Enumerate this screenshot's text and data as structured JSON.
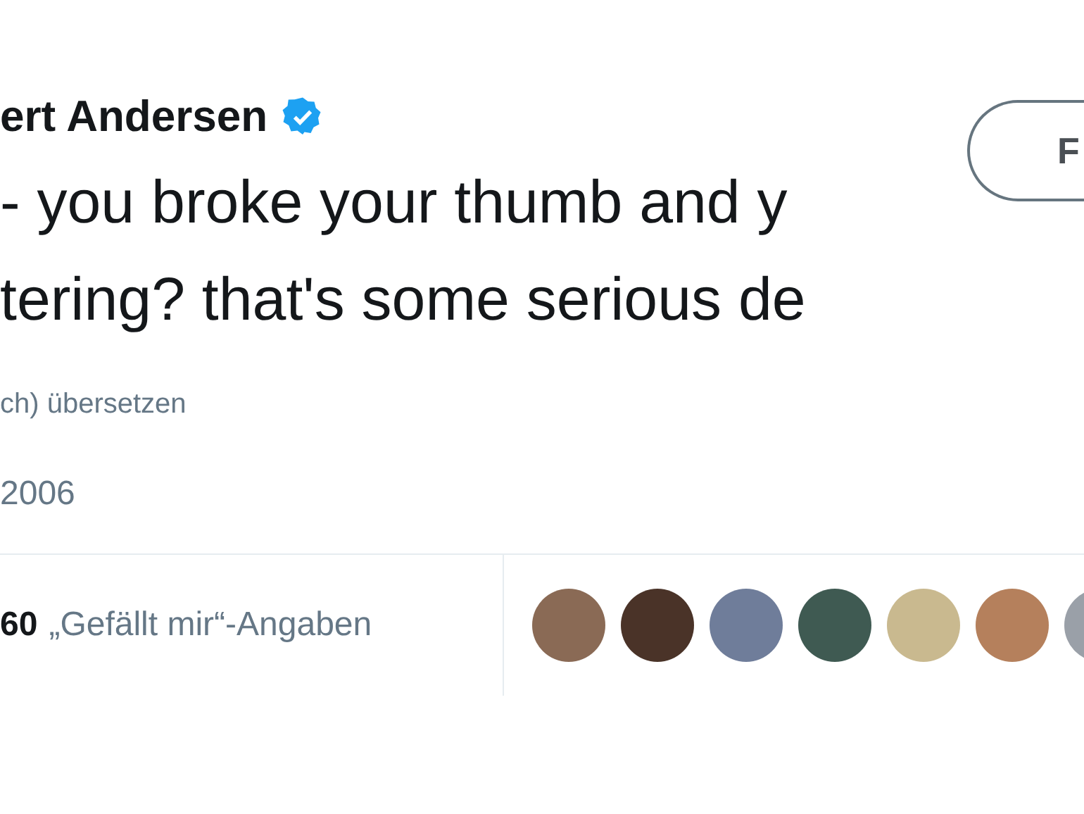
{
  "author": {
    "name": "ert Andersen",
    "verified": true
  },
  "follow_button": {
    "label": "F"
  },
  "tweet_text": [
    "- you broke your thumb and y",
    "tering? that's some serious de"
  ],
  "translate_link": "ch) übersetzen",
  "date": "2006",
  "likes": {
    "count": "60",
    "label": "„Gefällt mir“-Angaben"
  },
  "liker_avatars": [
    {
      "color": "#8a6a55"
    },
    {
      "color": "#4a3328"
    },
    {
      "color": "#6f7d9a"
    },
    {
      "color": "#3f5a52"
    },
    {
      "color": "#c9b98f"
    },
    {
      "color": "#b5805c"
    },
    {
      "color": "#9aa0a8"
    }
  ]
}
